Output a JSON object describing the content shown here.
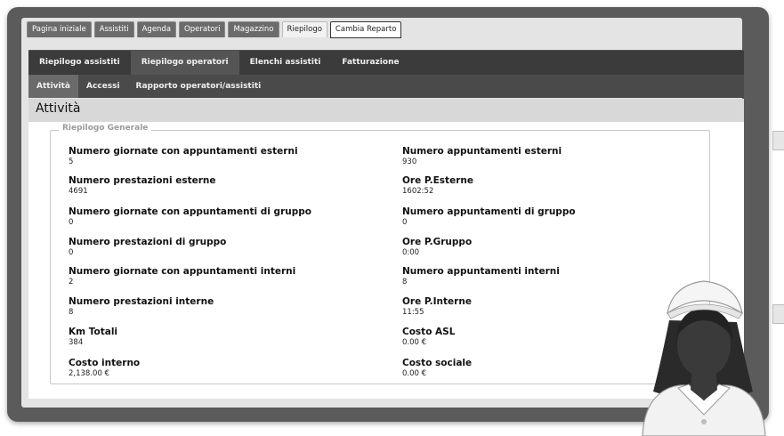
{
  "top_tabs": [
    {
      "label": "Pagina iniziale"
    },
    {
      "label": "Assistiti"
    },
    {
      "label": "Agenda"
    },
    {
      "label": "Operatori"
    },
    {
      "label": "Magazzino"
    },
    {
      "label": "Riepilogo",
      "active": true
    },
    {
      "label": "Cambia Reparto",
      "special": true
    }
  ],
  "sub_nav": [
    {
      "label": "Riepilogo assistiti"
    },
    {
      "label": "Riepilogo operatori",
      "active": true
    },
    {
      "label": "Elenchi assistiti"
    },
    {
      "label": "Fatturazione"
    }
  ],
  "third_nav": [
    {
      "label": "Attività",
      "active": true
    },
    {
      "label": "Accessi"
    },
    {
      "label": "Rapporto operatori/assistiti"
    }
  ],
  "page_title": "Attività",
  "section": {
    "legend": "Riepilogo Generale",
    "left": [
      {
        "label": "Numero giornate con appuntamenti esterni",
        "value": "5"
      },
      {
        "label": "Numero prestazioni esterne",
        "value": "4691"
      },
      {
        "label": "Numero giornate con appuntamenti di gruppo",
        "value": "0"
      },
      {
        "label": "Numero prestazioni di gruppo",
        "value": "0"
      },
      {
        "label": "Numero giornate con appuntamenti interni",
        "value": "2"
      },
      {
        "label": "Numero prestazioni interne",
        "value": "8"
      },
      {
        "label": "Km Totali",
        "value": "384"
      },
      {
        "label": "Costo interno",
        "value": "2,138.00 €"
      }
    ],
    "right": [
      {
        "label": "Numero appuntamenti esterni",
        "value": "930"
      },
      {
        "label": "Ore P.Esterne",
        "value": "1602:52"
      },
      {
        "label": "Numero appuntamenti di gruppo",
        "value": "0"
      },
      {
        "label": "Ore P.Gruppo",
        "value": "0:00"
      },
      {
        "label": "Numero appuntamenti interni",
        "value": "8"
      },
      {
        "label": "Ore P.Interne",
        "value": "11:55"
      },
      {
        "label": "Costo ASL",
        "value": "0.00 €"
      },
      {
        "label": "Costo sociale",
        "value": "0.00 €"
      }
    ]
  },
  "colors": {
    "frame": "#5b5b5b",
    "nav_dark": "#3b3b3b",
    "nav_mid": "#4a4a4a",
    "nurse_skin": "#3a3a3a",
    "nurse_uniform": "#f2f2f2"
  },
  "illustration": {
    "icon": "nurse-icon"
  }
}
